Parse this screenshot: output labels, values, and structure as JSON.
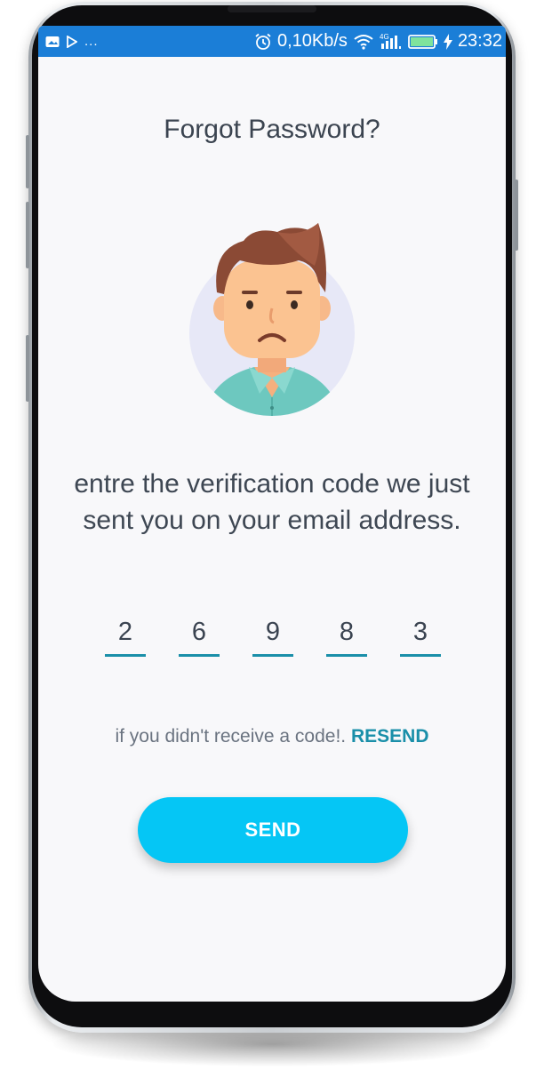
{
  "status_bar": {
    "left_icons": [
      "image-icon",
      "play-icon"
    ],
    "dots": "...",
    "right_icons": [
      "alarm-icon",
      "wifi-icon",
      "signal-4g-icon",
      "battery-icon",
      "charging-icon"
    ],
    "network_speed": "0,10Kb/s",
    "network_badge": "4G",
    "time": "23:32",
    "color": "#1b7ed7"
  },
  "screen": {
    "title": "Forgot Password?",
    "avatar_icon": "sad-user-avatar-icon",
    "message": "entre the verification code we just sent you on your email address.",
    "code_digits": [
      "2",
      "6",
      "9",
      "8",
      "3"
    ],
    "resend_prompt": "if you didn't receive a code!.",
    "resend_label": "RESEND",
    "send_label": "SEND"
  },
  "colors": {
    "accent": "#05c6f5",
    "link": "#1a8fa9",
    "text": "#3b4450",
    "background": "#f8f8fa"
  }
}
